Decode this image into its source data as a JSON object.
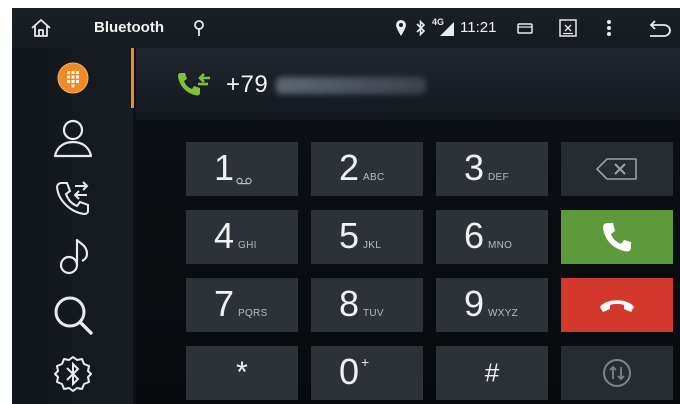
{
  "statusbar": {
    "app_title": "Bluetooth",
    "network": "4G",
    "time": "11:21"
  },
  "call": {
    "number_prefix": "+79"
  },
  "keypad": [
    {
      "digit": "1",
      "letters": ""
    },
    {
      "digit": "2",
      "letters": "ABC"
    },
    {
      "digit": "3",
      "letters": "DEF"
    },
    {
      "digit": "4",
      "letters": "GHI"
    },
    {
      "digit": "5",
      "letters": "JKL"
    },
    {
      "digit": "6",
      "letters": "MNO"
    },
    {
      "digit": "7",
      "letters": "PQRS"
    },
    {
      "digit": "8",
      "letters": "TUV"
    },
    {
      "digit": "9",
      "letters": "WXYZ"
    },
    {
      "digit": "*",
      "letters": ""
    },
    {
      "digit": "0",
      "letters": "+"
    },
    {
      "digit": "#",
      "letters": ""
    }
  ],
  "icons": {
    "home": "home-icon",
    "pin": "pin-icon",
    "location": "location-icon",
    "bluetooth": "bluetooth-icon",
    "signal": "signal-icon",
    "window": "window-icon",
    "close": "close-box-icon",
    "menu": "menu-dots-icon",
    "back": "back-icon",
    "sidebar": [
      "dialpad-icon",
      "contacts-icon",
      "call-log-icon",
      "music-icon",
      "search-icon",
      "bluetooth-settings-icon"
    ],
    "voicemail": "voicemail-icon",
    "backspace": "backspace-icon",
    "call": "call-icon",
    "hangup": "hangup-icon",
    "transfer": "audio-transfer-icon"
  },
  "colors": {
    "accent": "#f08a24",
    "call": "#5e9a3c",
    "hangup": "#d2392c",
    "key": "#2d3238",
    "call_icon": "#7ec23a"
  }
}
